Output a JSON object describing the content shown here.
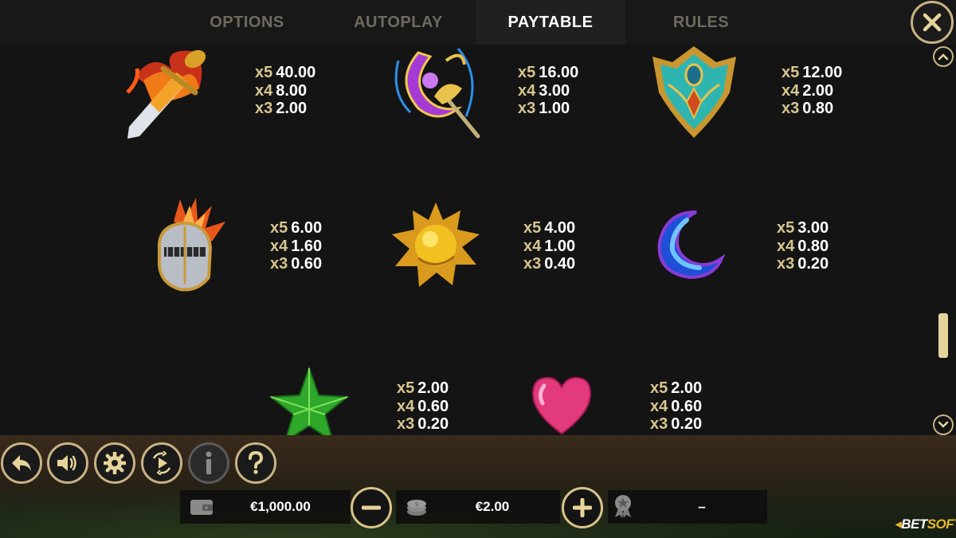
{
  "tabs": {
    "options": "OPTIONS",
    "autoplay": "AUTOPLAY",
    "paytable": "PAYTABLE",
    "rules": "RULES"
  },
  "close_icon": "close-icon",
  "symbols": [
    {
      "icon": "flaming-sword-icon",
      "payouts": [
        {
          "mult": "x5",
          "value": "40.00"
        },
        {
          "mult": "x4",
          "value": "8.00"
        },
        {
          "mult": "x3",
          "value": "2.00"
        }
      ]
    },
    {
      "icon": "moon-staff-icon",
      "payouts": [
        {
          "mult": "x5",
          "value": "16.00"
        },
        {
          "mult": "x4",
          "value": "3.00"
        },
        {
          "mult": "x3",
          "value": "1.00"
        }
      ]
    },
    {
      "icon": "shield-icon",
      "payouts": [
        {
          "mult": "x5",
          "value": "12.00"
        },
        {
          "mult": "x4",
          "value": "2.00"
        },
        {
          "mult": "x3",
          "value": "0.80"
        }
      ]
    },
    {
      "icon": "knight-helmet-icon",
      "payouts": [
        {
          "mult": "x5",
          "value": "6.00"
        },
        {
          "mult": "x4",
          "value": "1.60"
        },
        {
          "mult": "x3",
          "value": "0.60"
        }
      ]
    },
    {
      "icon": "sun-icon",
      "payouts": [
        {
          "mult": "x5",
          "value": "4.00"
        },
        {
          "mult": "x4",
          "value": "1.00"
        },
        {
          "mult": "x3",
          "value": "0.40"
        }
      ]
    },
    {
      "icon": "crescent-moon-icon",
      "payouts": [
        {
          "mult": "x5",
          "value": "3.00"
        },
        {
          "mult": "x4",
          "value": "0.80"
        },
        {
          "mult": "x3",
          "value": "0.20"
        }
      ]
    },
    {
      "icon": "green-star-icon",
      "payouts": [
        {
          "mult": "x5",
          "value": "2.00"
        },
        {
          "mult": "x4",
          "value": "0.60"
        },
        {
          "mult": "x3",
          "value": "0.20"
        }
      ]
    },
    {
      "icon": "pink-heart-icon",
      "payouts": [
        {
          "mult": "x5",
          "value": "2.00"
        },
        {
          "mult": "x4",
          "value": "0.60"
        },
        {
          "mult": "x3",
          "value": "0.20"
        }
      ]
    }
  ],
  "controls": [
    "back-icon",
    "sound-icon",
    "gear-icon",
    "autoplay-icon",
    "info-icon",
    "help-icon"
  ],
  "balance": {
    "icon": "wallet-icon",
    "value": "€1,000.00"
  },
  "bet": {
    "icon": "coin-stack-icon",
    "value": "€2.00"
  },
  "win": {
    "icon": "award-icon",
    "value": "–"
  },
  "brand": {
    "part1": "BET",
    "part2": "SOFT"
  },
  "colors": {
    "accent_gold": "#c9b384",
    "tab_inactive": "#6d6b5e",
    "multiplier": "#d8c690",
    "brand_yellow": "#e8b92a"
  }
}
